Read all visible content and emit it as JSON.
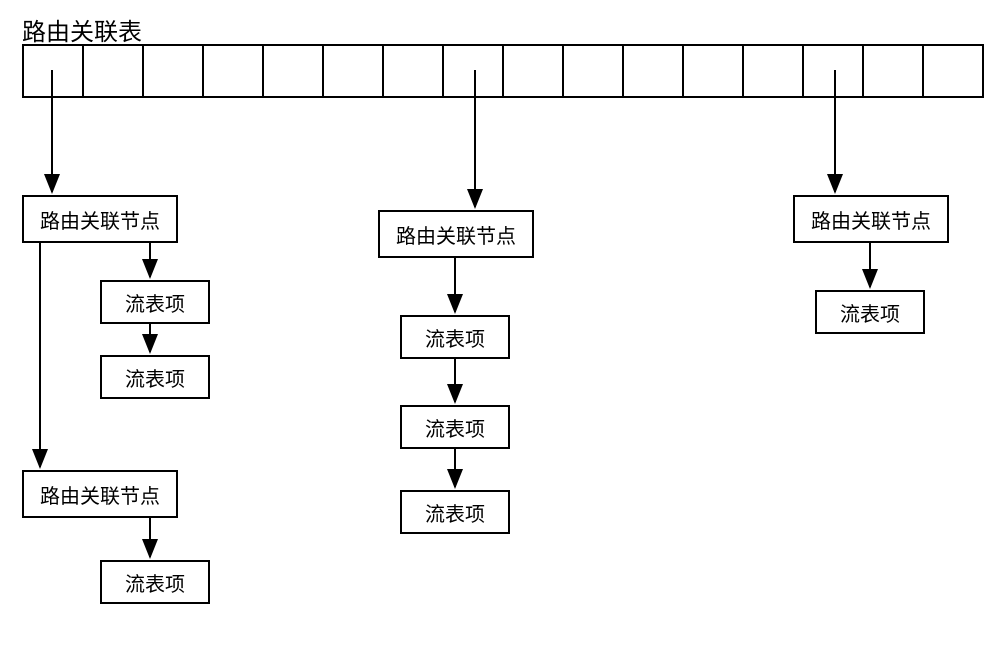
{
  "title": "路由关联表",
  "labels": {
    "routeNode": "路由关联节点",
    "flowEntry": "流表项"
  },
  "tableCells": 16
}
